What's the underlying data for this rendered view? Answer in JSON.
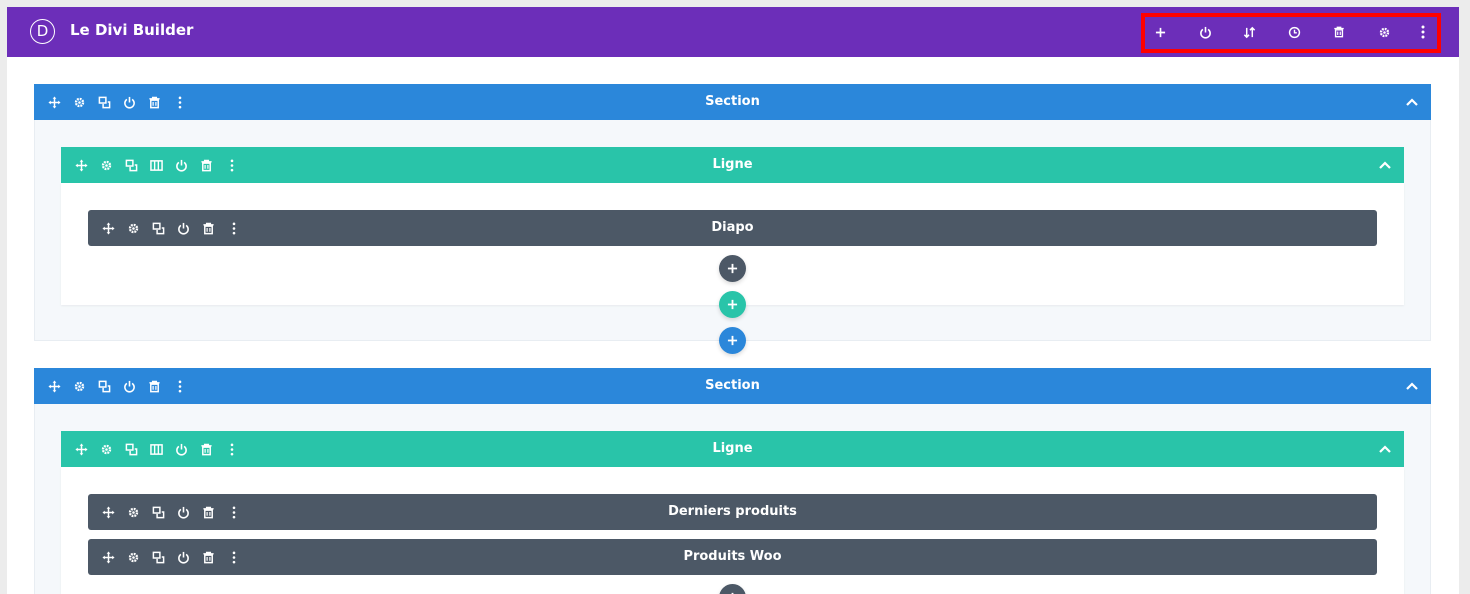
{
  "app": {
    "logo_letter": "D",
    "title": "Le Divi Builder"
  },
  "header_actions": [
    {
      "name": "add-icon",
      "label": "add"
    },
    {
      "name": "power-icon",
      "label": "disable"
    },
    {
      "name": "sort-icon",
      "label": "portability"
    },
    {
      "name": "history-icon",
      "label": "history"
    },
    {
      "name": "trash-icon",
      "label": "clear"
    },
    {
      "name": "gear-icon",
      "label": "settings"
    },
    {
      "name": "more-icon",
      "label": "more"
    }
  ],
  "sections": [
    {
      "label": "Section",
      "rows": [
        {
          "label": "Ligne",
          "modules": [
            {
              "label": "Diapo"
            }
          ]
        }
      ]
    },
    {
      "label": "Section",
      "rows": [
        {
          "label": "Ligne",
          "modules": [
            {
              "label": "Derniers produits"
            },
            {
              "label": "Produits Woo"
            }
          ]
        }
      ]
    }
  ],
  "colors": {
    "header": "#6c2eb9",
    "section": "#2b87da",
    "row": "#29c4a9",
    "module": "#4c5866",
    "highlight": "#ff0000"
  }
}
